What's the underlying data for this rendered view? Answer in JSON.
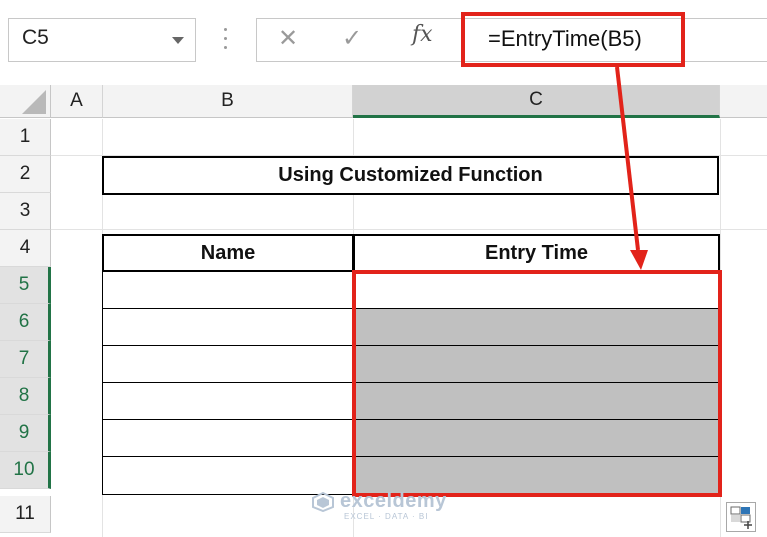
{
  "name_box": {
    "value": "C5"
  },
  "formula_bar": {
    "cancel_icon": "close-icon",
    "enter_icon": "check-icon",
    "function_icon": "fx",
    "formula": "=EntryTime(B5)"
  },
  "columns": [
    "A",
    "B",
    "C"
  ],
  "selected_column": "C",
  "rows": [
    "1",
    "2",
    "3",
    "4",
    "5",
    "6",
    "7",
    "8",
    "9",
    "10",
    "11"
  ],
  "selected_rows": [
    "5",
    "6",
    "7",
    "8",
    "9",
    "10"
  ],
  "sheet": {
    "title": "Using Customized Function",
    "table_headers": {
      "name": "Name",
      "entry_time": "Entry Time"
    },
    "name_values": [
      "",
      "",
      "",
      "",
      "",
      ""
    ],
    "entry_time_values": [
      "",
      "",
      "",
      "",
      "",
      ""
    ]
  },
  "watermark": {
    "brand": "exceldemy",
    "tagline": "EXCEL · DATA · BI"
  },
  "colors": {
    "highlight": "#e2231a",
    "selection_accent": "#217346",
    "filled_cell": "#c0c0c0"
  }
}
